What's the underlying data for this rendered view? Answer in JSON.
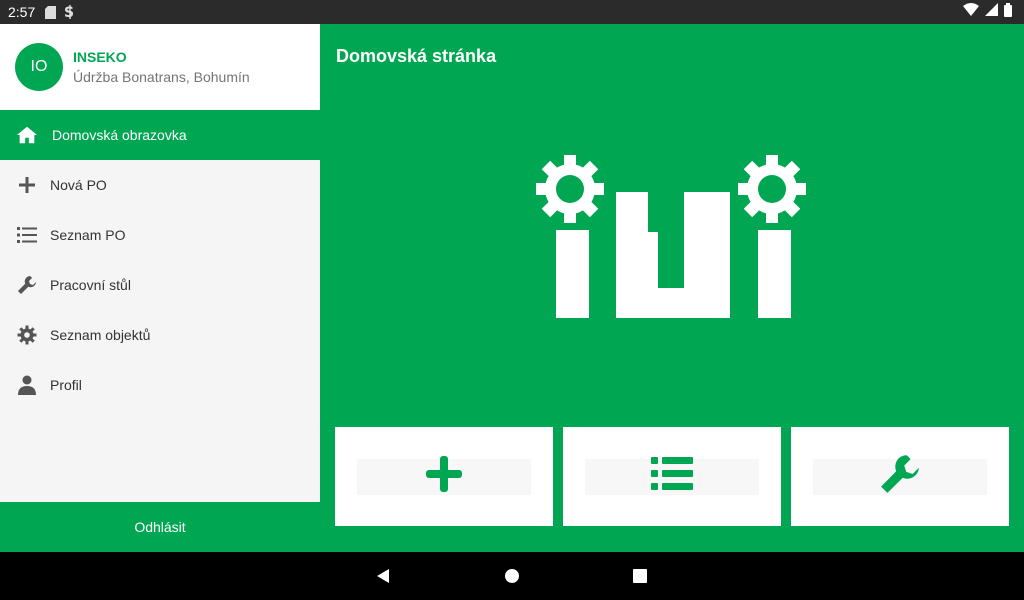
{
  "status_bar": {
    "time": "2:57",
    "left_icons": [
      "sd-card-icon",
      "sync-icon"
    ],
    "right_icons": [
      "wifi-icon",
      "signal-icon",
      "battery-icon"
    ]
  },
  "drawer": {
    "avatar_initials": "IO",
    "company": "INSEKO",
    "subtitle": "Údržba Bonatrans, Bohumín",
    "items": [
      {
        "label": "Domovská obrazovka",
        "icon": "home-icon",
        "active": true
      },
      {
        "label": "Nová PO",
        "icon": "plus-icon",
        "active": false
      },
      {
        "label": "Seznam PO",
        "icon": "list-icon",
        "active": false
      },
      {
        "label": "Pracovní stůl",
        "icon": "wrench-icon",
        "active": false
      },
      {
        "label": "Seznam objektů",
        "icon": "gear-icon",
        "active": false
      },
      {
        "label": "Profil",
        "icon": "person-icon",
        "active": false
      }
    ],
    "logout_label": "Odhlásit"
  },
  "main": {
    "title": "Domovská stránka",
    "tiles": [
      {
        "icon": "plus-icon"
      },
      {
        "icon": "list-icon"
      },
      {
        "icon": "wrench-icon"
      }
    ]
  },
  "colors": {
    "accent": "#00a651",
    "drawer_bg": "#f5f5f5",
    "tile_bg": "#ffffff"
  },
  "nav_bar": {
    "buttons": [
      "back-icon",
      "home-circle-icon",
      "recents-icon"
    ]
  }
}
